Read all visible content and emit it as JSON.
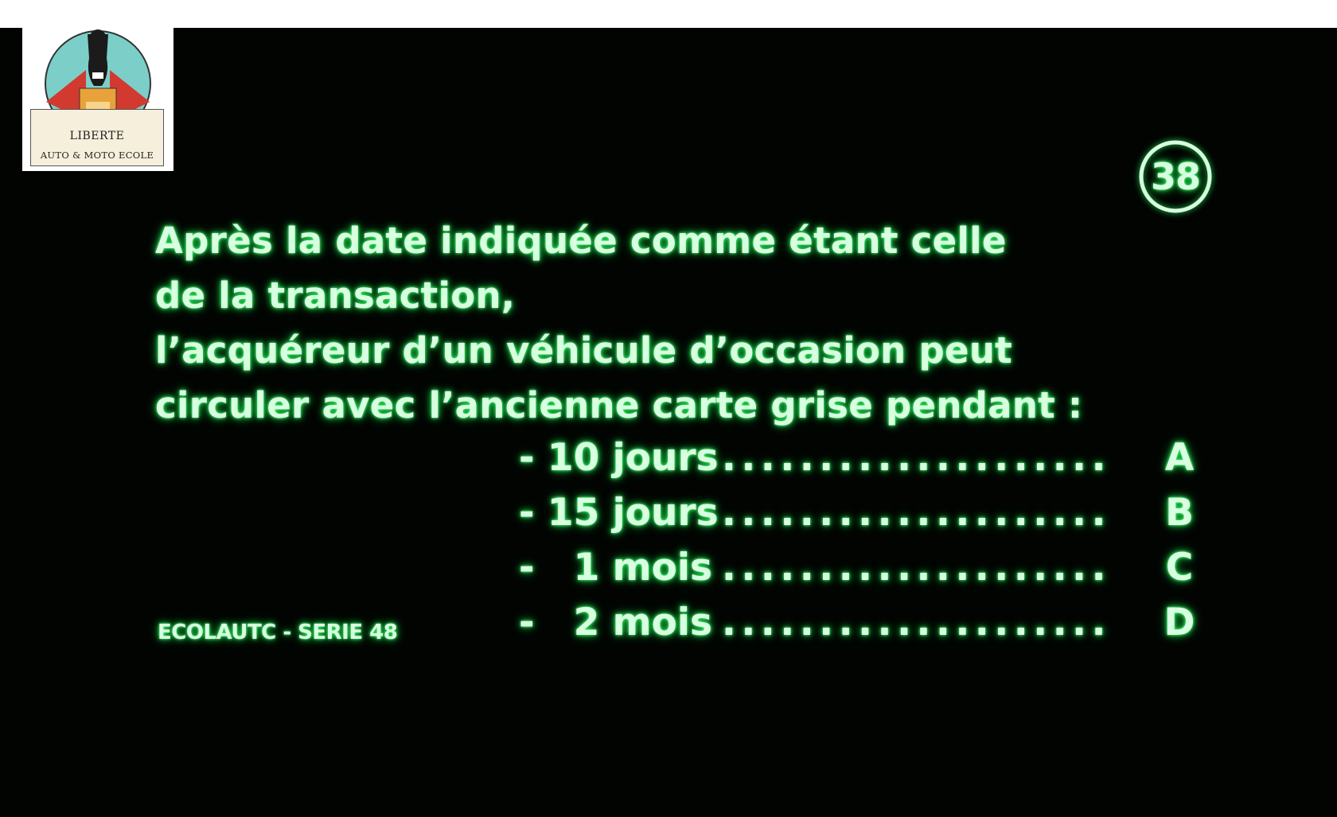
{
  "logo": {
    "line1": "LIBERTE",
    "line2": "AUTO & MOTO ECOLE"
  },
  "question_number": "38",
  "question_lines": [
    "Après la date indiquée comme étant celle",
    "de la transaction,",
    "l’acquéreur d’un véhicule d’occasion peut",
    "circuler avec l’ancienne carte grise pendant :"
  ],
  "answers": [
    {
      "label": "- 10 jours",
      "dots": "....................",
      "letter": "A"
    },
    {
      "label": "- 15 jours",
      "dots": "....................",
      "letter": "B"
    },
    {
      "label": "-   1 mois",
      "dots": "....................",
      "letter": "C"
    },
    {
      "label": "-   2 mois",
      "dots": "....................",
      "letter": "D"
    }
  ],
  "series_label": "ECOLAUTC - SERIE 48",
  "colors": {
    "screen_background": "#020402",
    "text": "#d8ffe0",
    "glow": "#1fd44c"
  }
}
